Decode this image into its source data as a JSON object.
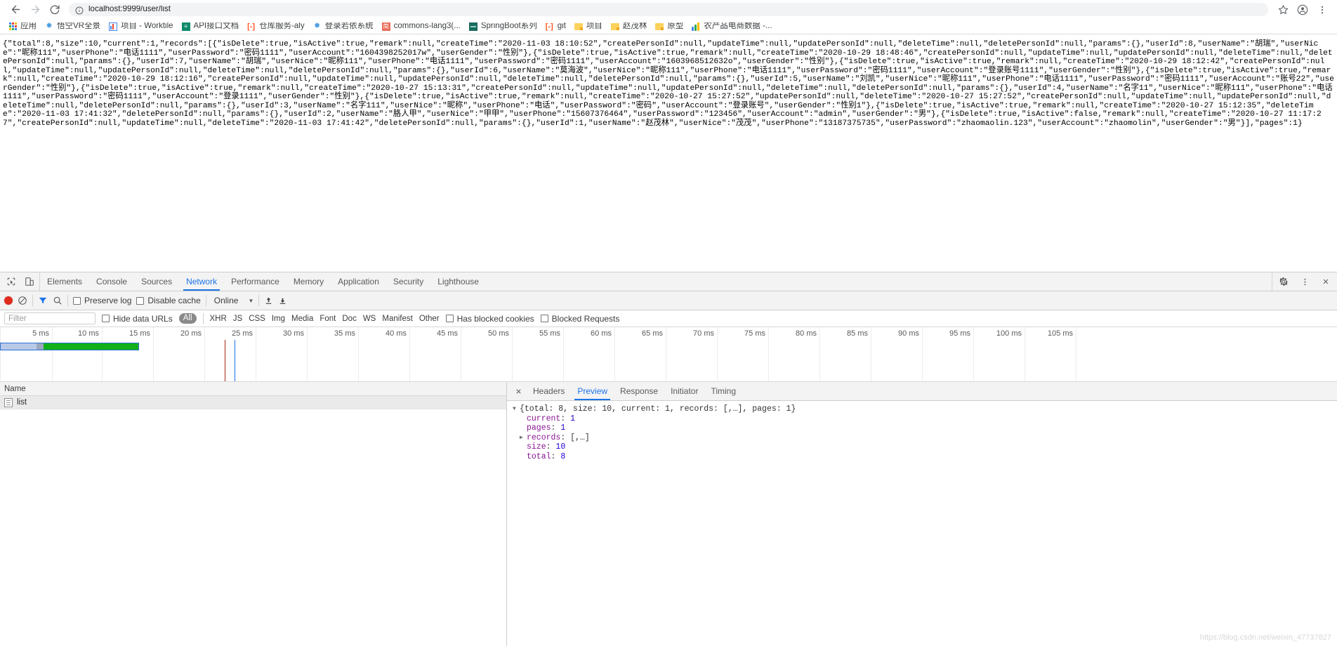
{
  "browser": {
    "back_label": "back",
    "forward_label": "forward",
    "reload_label": "reload",
    "url": "localhost:9999/user/list",
    "url_host": "localhost:9999",
    "url_path": "/user/list",
    "site_info_icon": "info-circle-icon",
    "star_icon": "bookmark-star-icon",
    "profile_icon": "user-avatar-icon",
    "menu_icon": "three-dots-menu-icon",
    "bookmarks": [
      {
        "label": "应用",
        "icon": "apps-grid-icon"
      },
      {
        "label": "悟空VR全景",
        "icon": "leaf-favicon"
      },
      {
        "label": "项目 - Worktile",
        "icon": "chart-favicon"
      },
      {
        "label": "API接口文档",
        "icon": "green-square-favicon"
      },
      {
        "label": "仓库服务-aly",
        "icon": "orange-bracket-favicon"
      },
      {
        "label": "登录若依系统",
        "icon": "leaf-favicon"
      },
      {
        "label": "commons-lang3(...",
        "icon": "jianshu-favicon"
      },
      {
        "label": "SpringBoot系列",
        "icon": "teal-favicon"
      },
      {
        "label": "git",
        "icon": "orange-bracket-favicon"
      },
      {
        "label": "项目",
        "icon": "folder-icon"
      },
      {
        "label": "赵茂林",
        "icon": "folder-icon"
      },
      {
        "label": "原型",
        "icon": "folder-icon"
      },
      {
        "label": "农产品电商数据 -...",
        "icon": "analytics-favicon"
      }
    ]
  },
  "page": {
    "json_response": "{\"total\":8,\"size\":10,\"current\":1,\"records\":[{\"isDelete\":true,\"isActive\":true,\"remark\":null,\"createTime\":\"2020-11-03 18:10:52\",\"createPersonId\":null,\"updateTime\":null,\"updatePersonId\":null,\"deleteTime\":null,\"deletePersonId\":null,\"params\":{},\"userId\":8,\"userName\":\"胡瑞\",\"userNice\":\"昵称111\",\"userPhone\":\"电话1111\",\"userPassword\":\"密码1111\",\"userAccount\":\"1604398252017w\",\"userGender\":\"性别\"},{\"isDelete\":true,\"isActive\":true,\"remark\":null,\"createTime\":\"2020-10-29 18:48:46\",\"createPersonId\":null,\"updateTime\":null,\"updatePersonId\":null,\"deleteTime\":null,\"deletePersonId\":null,\"params\":{},\"userId\":7,\"userName\":\"胡瑞\",\"userNice\":\"昵称111\",\"userPhone\":\"电话1111\",\"userPassword\":\"密码1111\",\"userAccount\":\"1603968512632o\",\"userGender\":\"性别\"},{\"isDelete\":true,\"isActive\":true,\"remark\":null,\"createTime\":\"2020-10-29 18:12:42\",\"createPersonId\":null,\"updateTime\":null,\"updatePersonId\":null,\"deleteTime\":null,\"deletePersonId\":null,\"params\":{},\"userId\":6,\"userName\":\"莫海波\",\"userNice\":\"昵称111\",\"userPhone\":\"电话1111\",\"userPassword\":\"密码1111\",\"userAccount\":\"登录账号1111\",\"userGender\":\"性别\"},{\"isDelete\":true,\"isActive\":true,\"remark\":null,\"createTime\":\"2020-10-29 18:12:16\",\"createPersonId\":null,\"updateTime\":null,\"updatePersonId\":null,\"deleteTime\":null,\"deletePersonId\":null,\"params\":{},\"userId\":5,\"userName\":\"刘凯\",\"userNice\":\"昵称111\",\"userPhone\":\"电话1111\",\"userPassword\":\"密码1111\",\"userAccount\":\"账号22\",\"userGender\":\"性别\"},{\"isDelete\":true,\"isActive\":true,\"remark\":null,\"createTime\":\"2020-10-27 15:13:31\",\"createPersonId\":null,\"updateTime\":null,\"updatePersonId\":null,\"deleteTime\":null,\"deletePersonId\":null,\"params\":{},\"userId\":4,\"userName\":\"名字11\",\"userNice\":\"昵称111\",\"userPhone\":\"电话1111\",\"userPassword\":\"密码1111\",\"userAccount\":\"登录1111\",\"userGender\":\"性别\"},{\"isDelete\":true,\"isActive\":true,\"remark\":null,\"createTime\":\"2020-10-27 15:27:52\",\"updatePersonId\":null,\"deleteTime\":\"2020-10-27 15:27:52\",\"createPersonId\":null,\"updateTime\":null,\"updatePersonId\":null,\"deleteTime\":null,\"deletePersonId\":null,\"params\":{},\"userId\":3,\"userName\":\"名字111\",\"userNice\":\"昵称\",\"userPhone\":\"电话\",\"userPassword\":\"密码\",\"userAccount\":\"登录账号\",\"userGender\":\"性别1\"},{\"isDelete\":true,\"isActive\":true,\"remark\":null,\"createTime\":\"2020-10-27 15:12:35\",\"deleteTime\":\"2020-11-03 17:41:32\",\"deletePersonId\":null,\"params\":{},\"userId\":2,\"userName\":\"胳人甲\",\"userNice\":\"甲甲\",\"userPhone\":\"15607376464\",\"userPassword\":\"123456\",\"userAccount\":\"admin\",\"userGender\":\"男\"},{\"isDelete\":true,\"isActive\":false,\"remark\":null,\"createTime\":\"2020-10-27 11:17:27\",\"createPersonId\":null,\"updateTime\":null,\"deleteTime\":\"2020-11-03 17:41:42\",\"deletePersonId\":null,\"params\":{},\"userId\":1,\"userName\":\"赵茂林\",\"userNice\":\"茂茂\",\"userPhone\":\"13187375735\",\"userPassword\":\"zhaomaolin.123\",\"userAccount\":\"zhaomolin\",\"userGender\":\"男\"}],\"pages\":1}"
  },
  "devtools": {
    "inspect_icon": "inspect-element-icon",
    "device_icon": "toggle-device-toolbar-icon",
    "settings_icon": "gear-icon",
    "more_icon": "three-dots-vertical-icon",
    "close_icon": "close-devtools-icon",
    "tabs": [
      {
        "label": "Elements",
        "active": false
      },
      {
        "label": "Console",
        "active": false
      },
      {
        "label": "Sources",
        "active": false
      },
      {
        "label": "Network",
        "active": true
      },
      {
        "label": "Performance",
        "active": false
      },
      {
        "label": "Memory",
        "active": false
      },
      {
        "label": "Application",
        "active": false
      },
      {
        "label": "Security",
        "active": false
      },
      {
        "label": "Lighthouse",
        "active": false
      }
    ],
    "controls": {
      "record_icon": "record-stop-icon",
      "clear_icon": "clear-network-log-icon",
      "filter_icon": "filter-funnel-icon",
      "search_icon": "search-icon",
      "preserve_log_label": "Preserve log",
      "preserve_log_checked": false,
      "disable_cache_label": "Disable cache",
      "disable_cache_checked": false,
      "throttling_value": "Online",
      "import_icon": "import-har-icon",
      "export_icon": "export-har-icon"
    },
    "filterbar": {
      "filter_placeholder": "Filter",
      "filter_value": "",
      "hide_data_urls_label": "Hide data URLs",
      "hide_data_urls_checked": false,
      "resource_types": [
        "All",
        "XHR",
        "JS",
        "CSS",
        "Img",
        "Media",
        "Font",
        "Doc",
        "WS",
        "Manifest",
        "Other"
      ],
      "resource_type_selected": "All",
      "has_blocked_cookies_label": "Has blocked cookies",
      "has_blocked_cookies_checked": false,
      "blocked_requests_label": "Blocked Requests",
      "blocked_requests_checked": false
    },
    "timeline": {
      "ticks": [
        "5 ms",
        "10 ms",
        "15 ms",
        "20 ms",
        "25 ms",
        "30 ms",
        "35 ms",
        "40 ms",
        "45 ms",
        "50 ms",
        "55 ms",
        "60 ms",
        "65 ms",
        "70 ms",
        "75 ms",
        "80 ms",
        "85 ms",
        "90 ms",
        "95 ms",
        "100 ms",
        "105 ms"
      ],
      "request_bar_start_ms": 0,
      "request_bar_end_ms": 15,
      "event_marker_red_ms": 24,
      "event_marker_blue_ms": 25
    },
    "request_table": {
      "columns": [
        "Name"
      ],
      "rows": [
        {
          "name": "list",
          "icon": "document-icon",
          "selected": true
        }
      ]
    },
    "detail": {
      "tabs": [
        {
          "label": "Headers",
          "active": false
        },
        {
          "label": "Preview",
          "active": true
        },
        {
          "label": "Response",
          "active": false
        },
        {
          "label": "Initiator",
          "active": false
        },
        {
          "label": "Timing",
          "active": false
        }
      ],
      "preview_root": "{total: 8, size: 10, current: 1, records: [,…], pages: 1}",
      "preview_entries": [
        {
          "key": "current",
          "value": "1",
          "type": "num",
          "expandable": false
        },
        {
          "key": "pages",
          "value": "1",
          "type": "num",
          "expandable": false
        },
        {
          "key": "records",
          "value": "[,…]",
          "type": "plain",
          "expandable": true
        },
        {
          "key": "size",
          "value": "10",
          "type": "num",
          "expandable": false
        },
        {
          "key": "total",
          "value": "8",
          "type": "num",
          "expandable": false
        }
      ]
    },
    "watermark": "https://blog.csdn.net/weixin_47737827"
  },
  "colors": {
    "accent": "#1a73e8",
    "record": "#e02a1c",
    "download_bar": "#11b019",
    "key": "#881391",
    "number": "#1c00cf"
  }
}
